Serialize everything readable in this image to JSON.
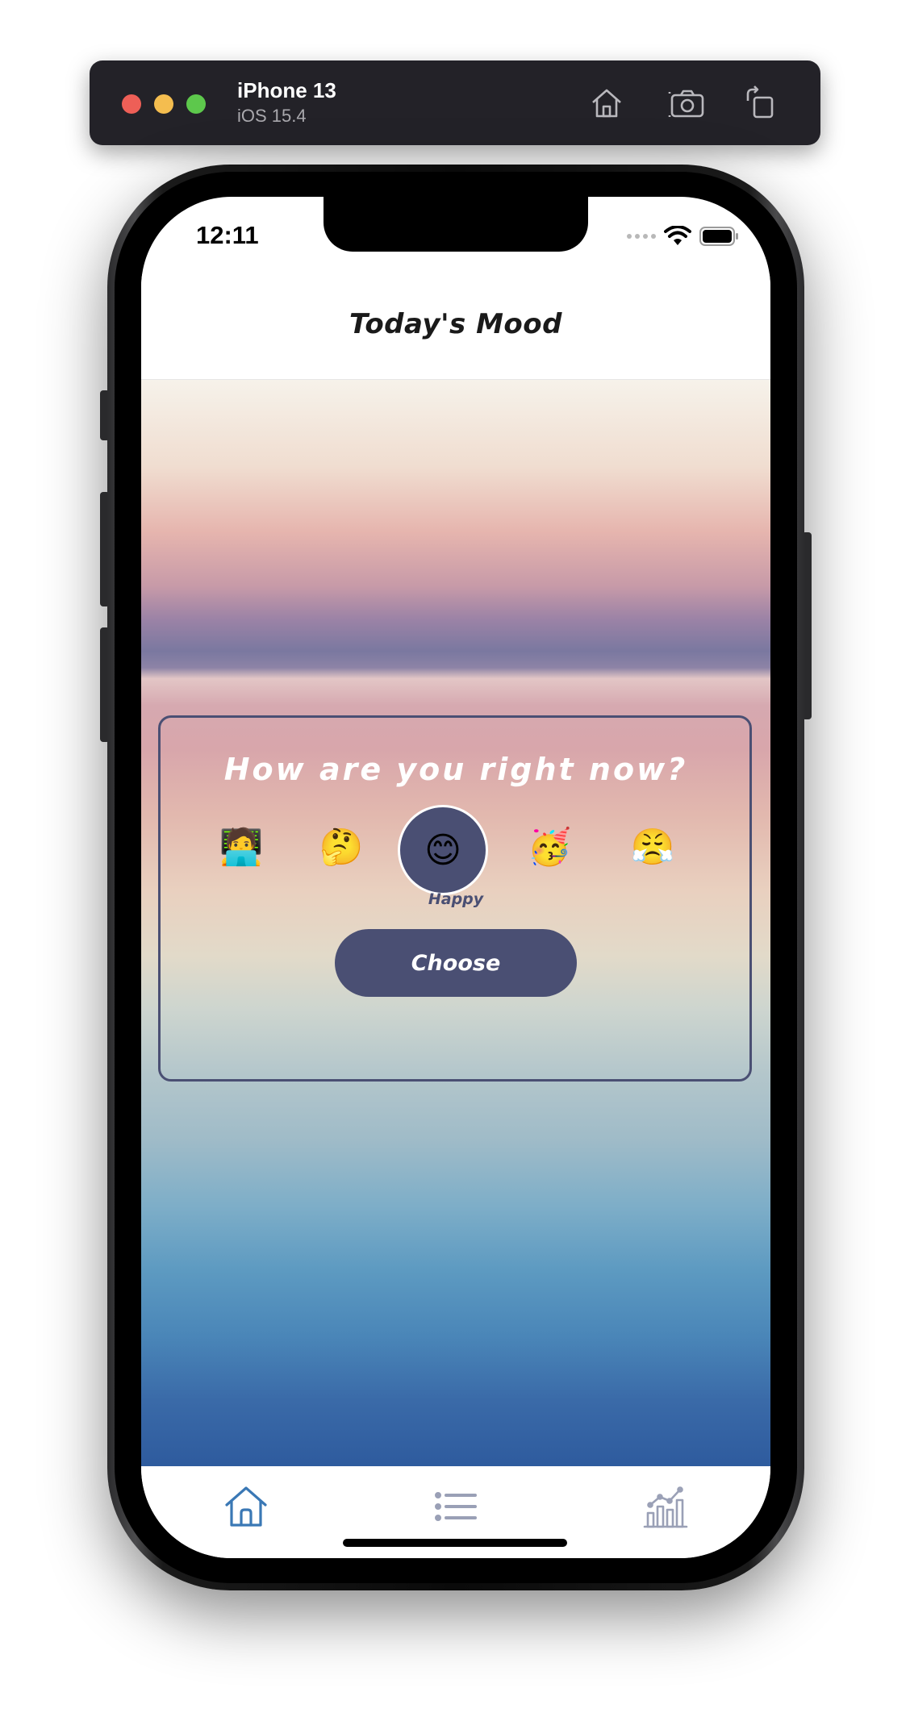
{
  "simulator": {
    "device_name": "iPhone 13",
    "os_version": "iOS 15.4",
    "icons": [
      "home-icon",
      "screenshot-icon",
      "rotate-icon"
    ]
  },
  "status_bar": {
    "time": "12:11",
    "icons": [
      "signal-icon",
      "wifi-icon",
      "battery-icon"
    ]
  },
  "nav": {
    "title": "Today's Mood"
  },
  "mood": {
    "question": "How are you right now?",
    "options": [
      {
        "emoji": "🧑‍💻",
        "name": "working"
      },
      {
        "emoji": "🤔",
        "name": "thinking"
      },
      {
        "emoji": "😊",
        "name": "happy"
      },
      {
        "emoji": "🥳",
        "name": "partying"
      },
      {
        "emoji": "😤",
        "name": "frustrated"
      }
    ],
    "selected_label": "Happy",
    "choose_label": "Choose"
  },
  "tabs": [
    {
      "icon": "home-icon",
      "active": true
    },
    {
      "icon": "list-icon",
      "active": false
    },
    {
      "icon": "chart-icon",
      "active": false
    }
  ],
  "colors": {
    "accent": "#4a4f73",
    "active_tab": "#3a78b5",
    "inactive_tab": "#9aa0b6"
  }
}
